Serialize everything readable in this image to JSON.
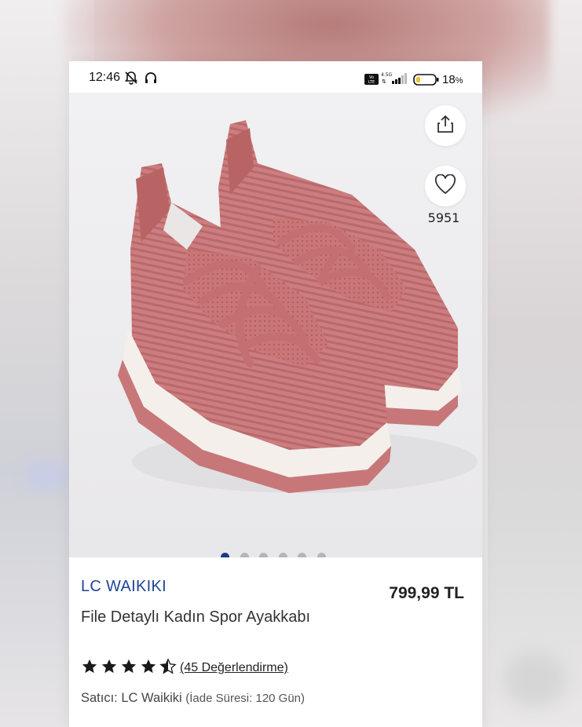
{
  "status_bar": {
    "time": "12:46",
    "network": "4.5G",
    "battery_percent": "18",
    "battery_suffix": "%"
  },
  "product_gallery": {
    "image_alt": "pink knit sneakers",
    "favorite_count": "5951",
    "total_images": 6,
    "active_image": 1
  },
  "product": {
    "brand": "LC WAIKIKI",
    "price": "799,99 TL",
    "title": "File Detaylı Kadın Spor Ayakkabı",
    "rating": 4.5,
    "reviews_label": "(45 Değerlendirme)",
    "seller_label": "Satıcı: LC Waikiki",
    "return_period": "(İade Süresi: 120 Gün)"
  },
  "colors": {
    "brand_blue": "#1f4596",
    "shoe_pink": "#c9787a",
    "sole_white": "#f4efea",
    "active_dot": "#1d3a8a"
  }
}
